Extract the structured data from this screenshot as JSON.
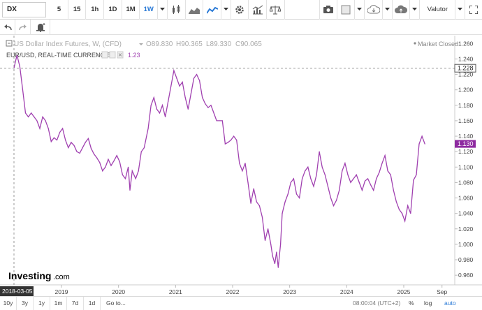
{
  "toolbar": {
    "symbol": "DX",
    "intervals": [
      "5",
      "15",
      "1h",
      "1D",
      "1M",
      "1W"
    ],
    "active_interval": "1W",
    "valutor_label": "Valutor",
    "icons": [
      "candle-chart-icon",
      "area-chart-icon",
      "line-chart-icon",
      "gear-icon",
      "indicators-icon",
      "scale-icon",
      "camera-icon",
      "layout-icon",
      "cloud-download-icon",
      "cloud-upload-icon",
      "fullscreen-icon"
    ]
  },
  "legend": {
    "main_title": "US Dollar Index Futures, W, (CFD)",
    "ohlc": [
      "O89.830",
      "H90.365",
      "L89.330",
      "C90.065"
    ],
    "compare_name": "EUR/USD, REAL-TIME CURRENCIES",
    "compare_value": "1.23",
    "market_status": "Market Closed"
  },
  "branding": {
    "logo_text": "Investing",
    "logo_suffix": ".com"
  },
  "chart_data": {
    "type": "line",
    "series_name": "EUR/USD, REAL-TIME CURRENCIES",
    "color": "#a040b0",
    "x_start": "2018-03-05",
    "y_ticks": [
      "1.260",
      "1.240",
      "1.220",
      "1.200",
      "1.180",
      "1.160",
      "1.140",
      "1.120",
      "1.100",
      "1.080",
      "1.060",
      "1.040",
      "1.020",
      "1.000",
      "0.980",
      "0.960"
    ],
    "x_ticks": [
      "2019",
      "2020",
      "2021",
      "2022",
      "2023",
      "2024",
      "2025",
      "Sep"
    ],
    "ylim": [
      0.952,
      1.263
    ],
    "crosshair_value": "1.228",
    "last_value": "1.130",
    "cursor_date": "2018-03-05",
    "points": [
      [
        2018.17,
        1.229
      ],
      [
        2018.22,
        1.245
      ],
      [
        2018.27,
        1.23
      ],
      [
        2018.32,
        1.2
      ],
      [
        2018.37,
        1.17
      ],
      [
        2018.42,
        1.165
      ],
      [
        2018.47,
        1.17
      ],
      [
        2018.52,
        1.165
      ],
      [
        2018.57,
        1.16
      ],
      [
        2018.62,
        1.15
      ],
      [
        2018.67,
        1.165
      ],
      [
        2018.72,
        1.16
      ],
      [
        2018.77,
        1.15
      ],
      [
        2018.82,
        1.133
      ],
      [
        2018.87,
        1.138
      ],
      [
        2018.92,
        1.135
      ],
      [
        2018.97,
        1.145
      ],
      [
        2019.02,
        1.15
      ],
      [
        2019.07,
        1.135
      ],
      [
        2019.12,
        1.125
      ],
      [
        2019.17,
        1.132
      ],
      [
        2019.22,
        1.128
      ],
      [
        2019.27,
        1.12
      ],
      [
        2019.32,
        1.118
      ],
      [
        2019.37,
        1.125
      ],
      [
        2019.42,
        1.132
      ],
      [
        2019.47,
        1.137
      ],
      [
        2019.52,
        1.124
      ],
      [
        2019.57,
        1.117
      ],
      [
        2019.62,
        1.112
      ],
      [
        2019.67,
        1.106
      ],
      [
        2019.72,
        1.095
      ],
      [
        2019.77,
        1.1
      ],
      [
        2019.82,
        1.11
      ],
      [
        2019.87,
        1.102
      ],
      [
        2019.92,
        1.108
      ],
      [
        2019.97,
        1.115
      ],
      [
        2020.02,
        1.107
      ],
      [
        2020.07,
        1.09
      ],
      [
        2020.12,
        1.085
      ],
      [
        2020.17,
        1.1
      ],
      [
        2020.2,
        1.07
      ],
      [
        2020.24,
        1.095
      ],
      [
        2020.3,
        1.085
      ],
      [
        2020.35,
        1.095
      ],
      [
        2020.4,
        1.12
      ],
      [
        2020.45,
        1.125
      ],
      [
        2020.52,
        1.15
      ],
      [
        2020.57,
        1.18
      ],
      [
        2020.62,
        1.19
      ],
      [
        2020.67,
        1.175
      ],
      [
        2020.72,
        1.17
      ],
      [
        2020.77,
        1.18
      ],
      [
        2020.82,
        1.165
      ],
      [
        2020.87,
        1.185
      ],
      [
        2020.92,
        1.205
      ],
      [
        2020.97,
        1.225
      ],
      [
        2021.02,
        1.215
      ],
      [
        2021.07,
        1.205
      ],
      [
        2021.12,
        1.21
      ],
      [
        2021.17,
        1.19
      ],
      [
        2021.22,
        1.175
      ],
      [
        2021.27,
        1.195
      ],
      [
        2021.32,
        1.215
      ],
      [
        2021.37,
        1.22
      ],
      [
        2021.42,
        1.212
      ],
      [
        2021.47,
        1.19
      ],
      [
        2021.52,
        1.182
      ],
      [
        2021.57,
        1.177
      ],
      [
        2021.62,
        1.18
      ],
      [
        2021.67,
        1.17
      ],
      [
        2021.72,
        1.16
      ],
      [
        2021.77,
        1.16
      ],
      [
        2021.82,
        1.16
      ],
      [
        2021.87,
        1.13
      ],
      [
        2021.92,
        1.132
      ],
      [
        2021.97,
        1.135
      ],
      [
        2022.02,
        1.14
      ],
      [
        2022.07,
        1.135
      ],
      [
        2022.12,
        1.105
      ],
      [
        2022.17,
        1.095
      ],
      [
        2022.22,
        1.105
      ],
      [
        2022.27,
        1.08
      ],
      [
        2022.32,
        1.053
      ],
      [
        2022.37,
        1.072
      ],
      [
        2022.42,
        1.055
      ],
      [
        2022.47,
        1.05
      ],
      [
        2022.52,
        1.035
      ],
      [
        2022.57,
        1.005
      ],
      [
        2022.62,
        1.02
      ],
      [
        2022.67,
        1.0
      ],
      [
        2022.7,
        0.985
      ],
      [
        2022.74,
        0.975
      ],
      [
        2022.77,
        0.99
      ],
      [
        2022.8,
        0.97
      ],
      [
        2022.84,
        1.0
      ],
      [
        2022.87,
        1.04
      ],
      [
        2022.92,
        1.055
      ],
      [
        2022.97,
        1.065
      ],
      [
        2023.02,
        1.08
      ],
      [
        2023.07,
        1.085
      ],
      [
        2023.12,
        1.065
      ],
      [
        2023.17,
        1.06
      ],
      [
        2023.22,
        1.085
      ],
      [
        2023.27,
        1.095
      ],
      [
        2023.32,
        1.1
      ],
      [
        2023.37,
        1.085
      ],
      [
        2023.42,
        1.075
      ],
      [
        2023.47,
        1.09
      ],
      [
        2023.52,
        1.12
      ],
      [
        2023.57,
        1.1
      ],
      [
        2023.62,
        1.09
      ],
      [
        2023.67,
        1.075
      ],
      [
        2023.72,
        1.06
      ],
      [
        2023.77,
        1.05
      ],
      [
        2023.82,
        1.057
      ],
      [
        2023.87,
        1.07
      ],
      [
        2023.92,
        1.095
      ],
      [
        2023.97,
        1.105
      ],
      [
        2024.02,
        1.09
      ],
      [
        2024.07,
        1.08
      ],
      [
        2024.12,
        1.085
      ],
      [
        2024.17,
        1.09
      ],
      [
        2024.22,
        1.08
      ],
      [
        2024.27,
        1.07
      ],
      [
        2024.32,
        1.082
      ],
      [
        2024.37,
        1.085
      ],
      [
        2024.42,
        1.077
      ],
      [
        2024.47,
        1.07
      ],
      [
        2024.52,
        1.085
      ],
      [
        2024.57,
        1.093
      ],
      [
        2024.62,
        1.105
      ],
      [
        2024.67,
        1.115
      ],
      [
        2024.72,
        1.095
      ],
      [
        2024.77,
        1.09
      ],
      [
        2024.82,
        1.07
      ],
      [
        2024.87,
        1.055
      ],
      [
        2024.92,
        1.045
      ],
      [
        2024.97,
        1.04
      ],
      [
        2025.02,
        1.03
      ],
      [
        2025.07,
        1.05
      ],
      [
        2025.12,
        1.04
      ],
      [
        2025.17,
        1.083
      ],
      [
        2025.22,
        1.09
      ],
      [
        2025.27,
        1.13
      ],
      [
        2025.32,
        1.14
      ],
      [
        2025.37,
        1.13
      ]
    ]
  },
  "bottom_bar": {
    "ranges": [
      "10y",
      "3y",
      "1y",
      "1m",
      "7d",
      "1d"
    ],
    "goto": "Go to...",
    "time": "08:00:04 (UTC+2)",
    "percent": "%",
    "log": "log",
    "auto": "auto"
  }
}
